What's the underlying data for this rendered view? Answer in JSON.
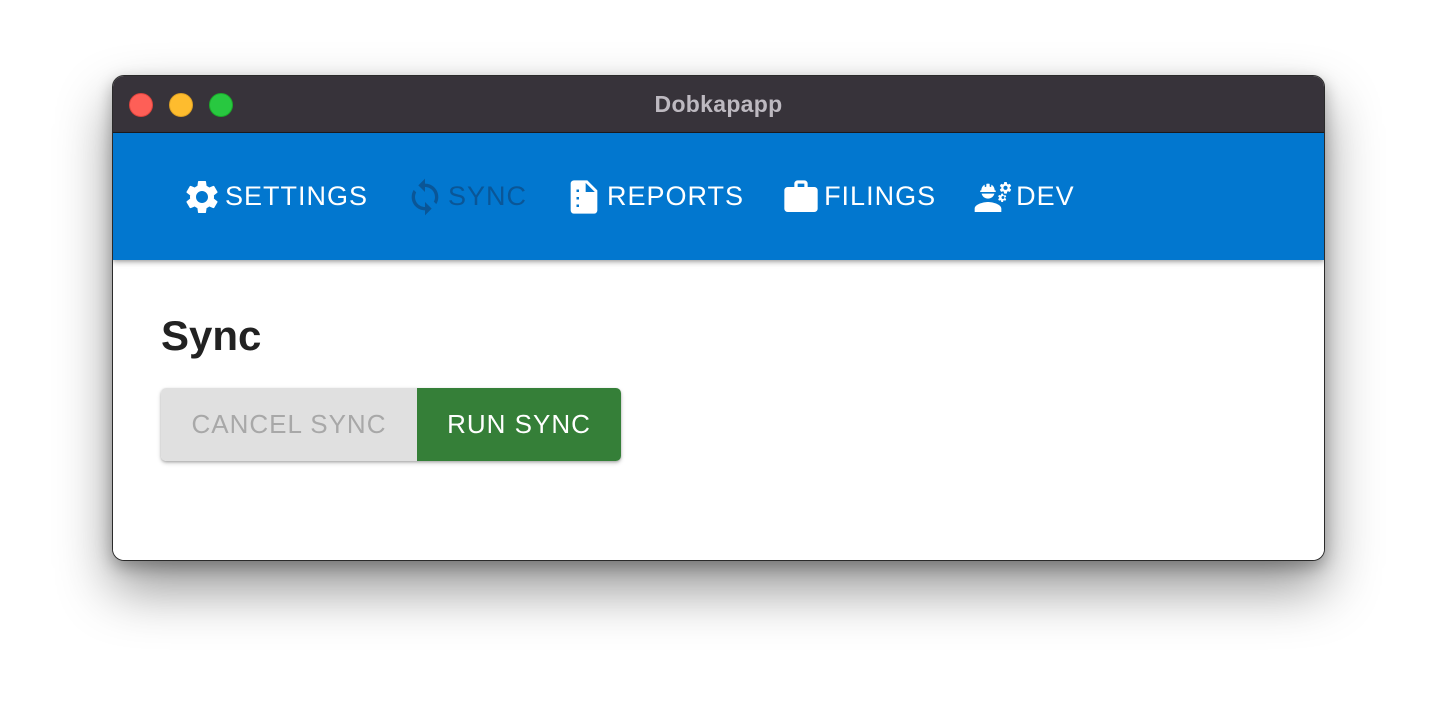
{
  "window": {
    "title": "Dobkapapp"
  },
  "nav": {
    "tabs": [
      {
        "label": "SETTINGS",
        "icon": "gear-icon",
        "active": false
      },
      {
        "label": "SYNC",
        "icon": "sync-icon",
        "active": true
      },
      {
        "label": "REPORTS",
        "icon": "report-file-icon",
        "active": false
      },
      {
        "label": "FILINGS",
        "icon": "briefcase-icon",
        "active": false
      },
      {
        "label": "DEV",
        "icon": "developer-icon",
        "active": false
      }
    ]
  },
  "main": {
    "title": "Sync",
    "cancel_button": "CANCEL SYNC",
    "cancel_disabled": true,
    "run_button": "RUN SYNC"
  },
  "colors": {
    "titlebar": "#37333a",
    "appbar": "#0277cf",
    "active_tab": "#0a5697",
    "run_button": "#357f38",
    "cancel_button": "#e0e0e0"
  }
}
